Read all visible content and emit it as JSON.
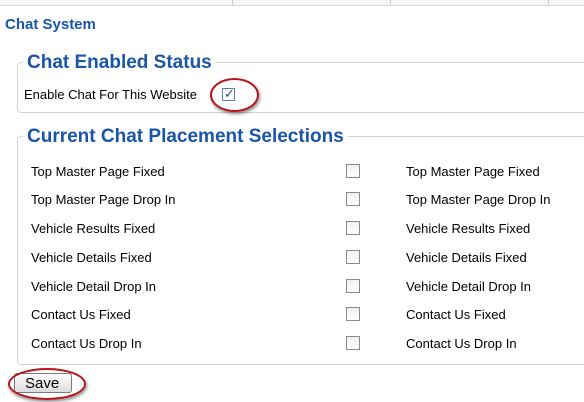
{
  "page_title": "Chat System",
  "status_section": {
    "legend": "Chat Enabled Status",
    "enable_label": "Enable Chat For This Website",
    "enabled": true
  },
  "placement_section": {
    "legend": "Current Chat Placement Selections",
    "rows": [
      {
        "label": "Top Master Page Fixed",
        "value_label": "Top Master Page Fixed",
        "checked": false
      },
      {
        "label": "Top Master Page Drop In",
        "value_label": "Top Master Page Drop In",
        "checked": false
      },
      {
        "label": "Vehicle Results Fixed",
        "value_label": "Vehicle Results Fixed",
        "checked": false
      },
      {
        "label": "Vehicle Details Fixed",
        "value_label": "Vehicle Details Fixed",
        "checked": false
      },
      {
        "label": "Vehicle Detail Drop In",
        "value_label": "Vehicle Detail Drop In",
        "checked": false
      },
      {
        "label": "Contact Us Fixed",
        "value_label": "Contact Us Fixed",
        "checked": false
      },
      {
        "label": "Contact Us Drop In",
        "value_label": "Contact Us Drop In",
        "checked": false
      }
    ]
  },
  "save_label": "Save",
  "colors": {
    "heading": "#1a55a8",
    "highlight": "#b5141b"
  }
}
